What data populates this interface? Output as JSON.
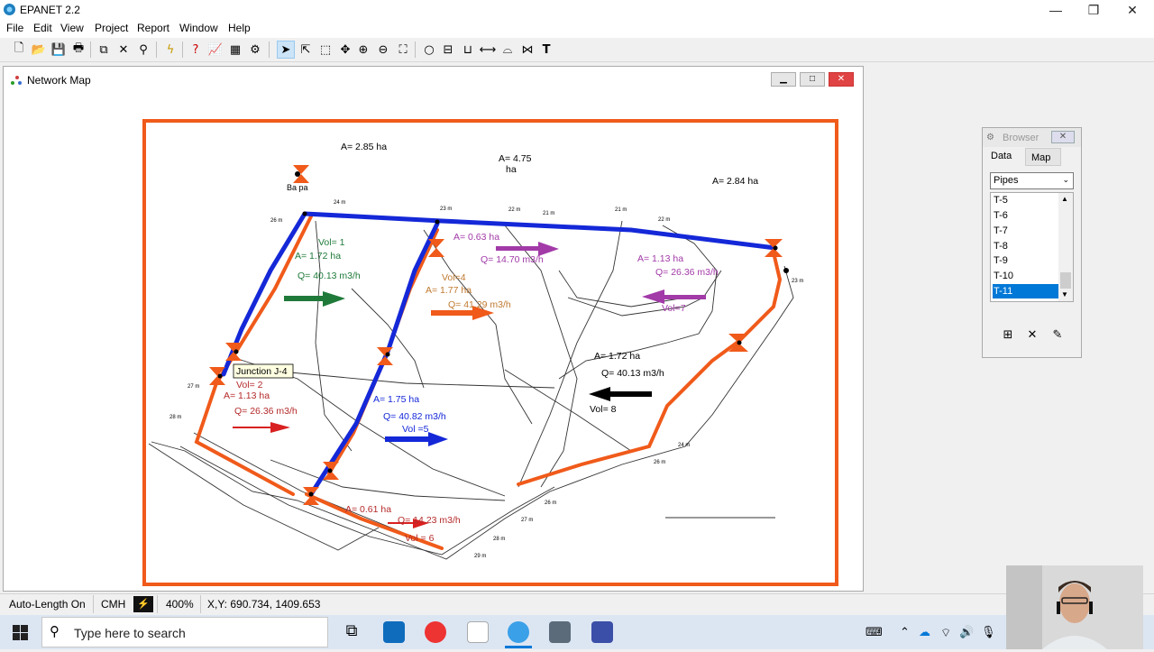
{
  "app": {
    "title": "EPANET 2.2"
  },
  "window_controls": {
    "minimize": "—",
    "restore": "❐",
    "close": "✕"
  },
  "menu": [
    "File",
    "Edit",
    "View",
    "Project",
    "Report",
    "Window",
    "Help"
  ],
  "network_map": {
    "title": "Network Map",
    "tooltip": "Junction J-4",
    "labels": {
      "area_top_left": "A= 2.85 ha",
      "area_top_mid_a": "A= 4.75",
      "area_top_mid_b": "ha",
      "area_top_right": "A= 2.84 ha",
      "reservoir": "Ba    pa",
      "vol1": "Vol= 1",
      "a1": "A= 1.72 ha",
      "q1": "Q= 40.13 m3/h",
      "a063": "A= 0.63 ha",
      "q1470": "Q= 14.70 m3/h",
      "vol4": "Vol=4",
      "a177": "A= 1.77 ha",
      "q4129": "Q= 41.29 m3/h",
      "a113r": "A= 1.13 ha",
      "q2636r": "Q= 26.36 m3/h",
      "vol7": "Vol=7",
      "a172r": "A= 1.72 ha",
      "q4013r": "Q= 40.13 m3/h",
      "vol8": "Vol= 8",
      "vol2": "Vol= 2",
      "a113": "A= 1.13 ha",
      "q2636": "Q= 26.36 m3/h",
      "a175": "A= 1.75 ha",
      "q4082": "Q= 40.82 m3/h",
      "vol5": "Vol =5",
      "a061": "A= 0.61 ha",
      "q1423": "Q= 14.23 m3/h",
      "vol6": "Vol = 6"
    },
    "colors": {
      "frame": "#f05a1a",
      "blue_pipe": "#1428d8",
      "orange_pipe": "#f05a1a",
      "green_arrow": "#1f7a3a",
      "purple_arrow": "#a23aa8",
      "red_arrow": "#d92020"
    }
  },
  "browser": {
    "title": "Browser",
    "tabs": [
      "Data",
      "Map"
    ],
    "selected_category": "Pipes",
    "items": [
      "T-5",
      "T-6",
      "T-7",
      "T-8",
      "T-9",
      "T-10",
      "T-11"
    ],
    "selected_item": "T-11"
  },
  "status": {
    "auto_length": "Auto-Length On",
    "units": "CMH",
    "zoom": "400%",
    "coords": "X,Y: 690.734, 1409.653"
  },
  "taskbar": {
    "search_placeholder": "Type here to search"
  }
}
